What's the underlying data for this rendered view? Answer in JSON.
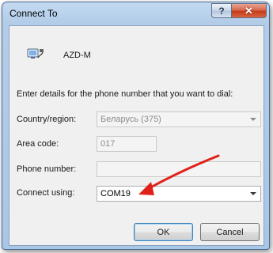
{
  "window": {
    "title": "Connect To"
  },
  "titlebar": {
    "help_glyph": "?",
    "close_glyph": "✕"
  },
  "connection": {
    "name": "AZD-M",
    "icon": "phone-connection-icon"
  },
  "prompt": "Enter details for the phone number that you want to dial:",
  "form": {
    "country_label": "Country/region:",
    "country_value": "Беларусь (375)",
    "area_label": "Area code:",
    "area_value": "017",
    "phone_label": "Phone number:",
    "phone_value": "",
    "connect_label": "Connect using:",
    "connect_value": "COM19"
  },
  "buttons": {
    "ok": "OK",
    "cancel": "Cancel"
  },
  "annotation": {
    "icon": "red-arrow-annotation",
    "color": "#e0211a"
  },
  "colors": {
    "titlebar": "#b3cde9",
    "client": "#f0f0f0",
    "close": "#c43c1c"
  }
}
